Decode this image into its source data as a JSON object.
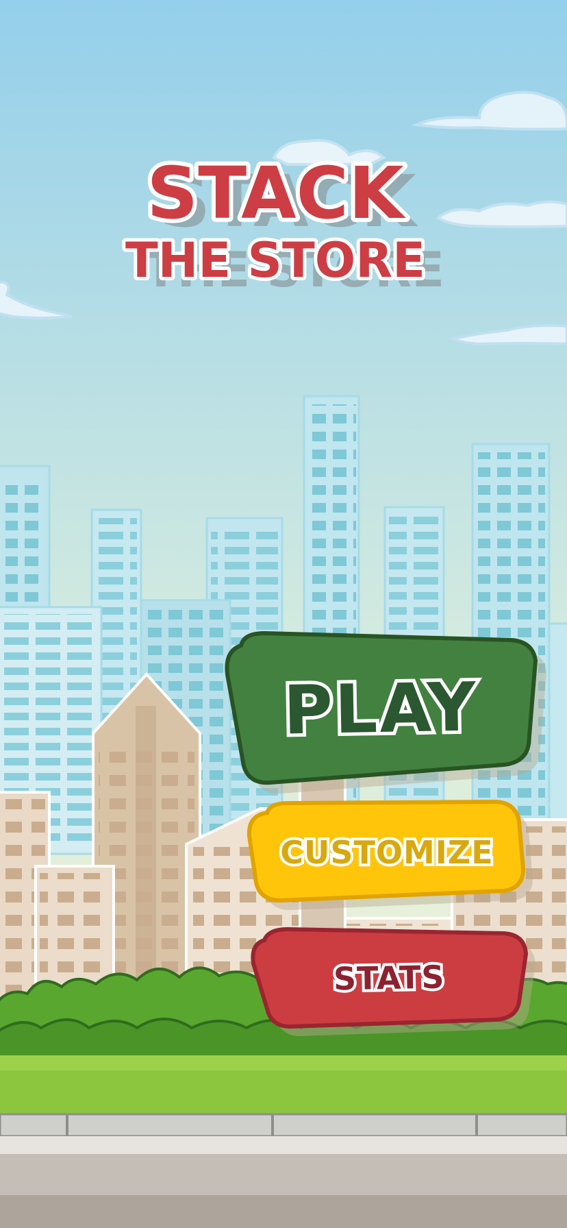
{
  "title": {
    "line1": "STACK",
    "line2": "THE STORE"
  },
  "menu": {
    "play_label": "PLAY",
    "customize_label": "CUSTOMIZE",
    "stats_label": "STATS"
  },
  "colors": {
    "sky_top": "#94cfeb",
    "sky_bottom": "#fbf5d3",
    "title_red": "#cc3e44",
    "play_green": "#438140",
    "customize_yellow": "#fec50b",
    "stats_red": "#cc3d42",
    "grass": "#8cc63f"
  }
}
